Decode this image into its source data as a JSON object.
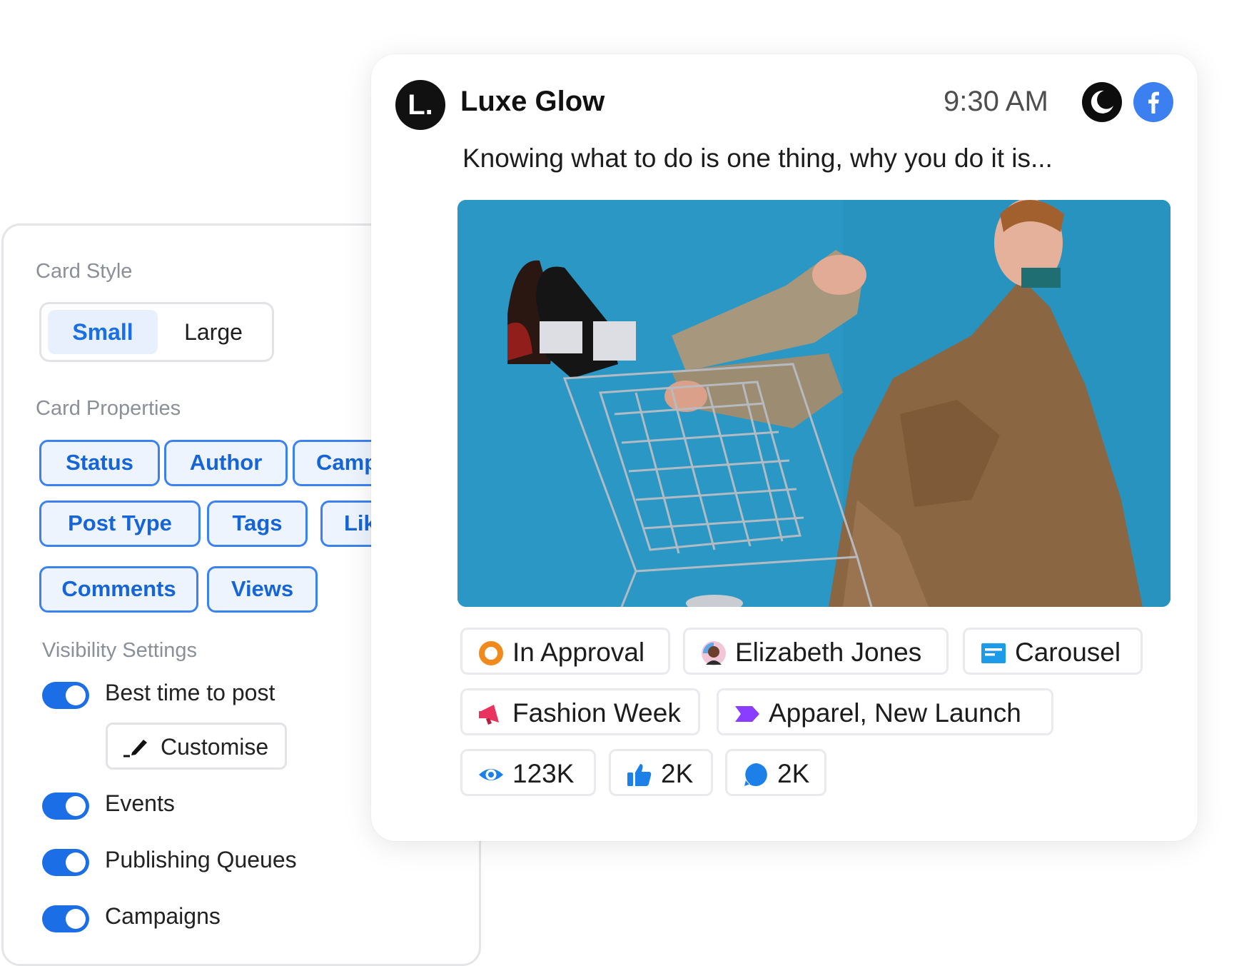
{
  "settings": {
    "card_style": {
      "title": "Card Style",
      "options": [
        "Small",
        "Large"
      ],
      "selected": "Small"
    },
    "card_properties": {
      "title": "Card Properties",
      "chips": [
        "Status",
        "Author",
        "Camp",
        "Post Type",
        "Tags",
        "Lik",
        "Comments",
        "Views"
      ]
    },
    "visibility": {
      "title": "Visibility Settings",
      "toggles": [
        {
          "label": "Best time to post",
          "on": true
        },
        {
          "label": "Events",
          "on": true
        },
        {
          "label": "Publishing Queues",
          "on": true
        },
        {
          "label": "Campaigns",
          "on": true
        }
      ],
      "customise_label": "Customise"
    }
  },
  "post": {
    "avatar_letter": "L.",
    "brand": "Luxe Glow",
    "time": "9:30 AM",
    "caption": "Knowing what to do is one thing, why you do it is...",
    "icons": [
      "moon-icon",
      "facebook-icon"
    ],
    "meta": {
      "status": "In Approval",
      "author": "Elizabeth Jones",
      "post_type": "Carousel",
      "campaign": "Fashion Week",
      "tags": "Apparel, New Launch",
      "views": "123K",
      "likes": "2K",
      "comments": "2K"
    }
  },
  "colors": {
    "accent": "#1b6ee6",
    "chip_border": "#3b82f0",
    "chip_bg": "#eef4fe",
    "status_orange": "#f08a1c",
    "campaign_pink": "#e8345f",
    "tag_purple": "#8b3dff",
    "carousel_blue": "#1d9be8",
    "facebook_blue": "#3b7ff0",
    "photo_bg": "#2a97c4"
  }
}
